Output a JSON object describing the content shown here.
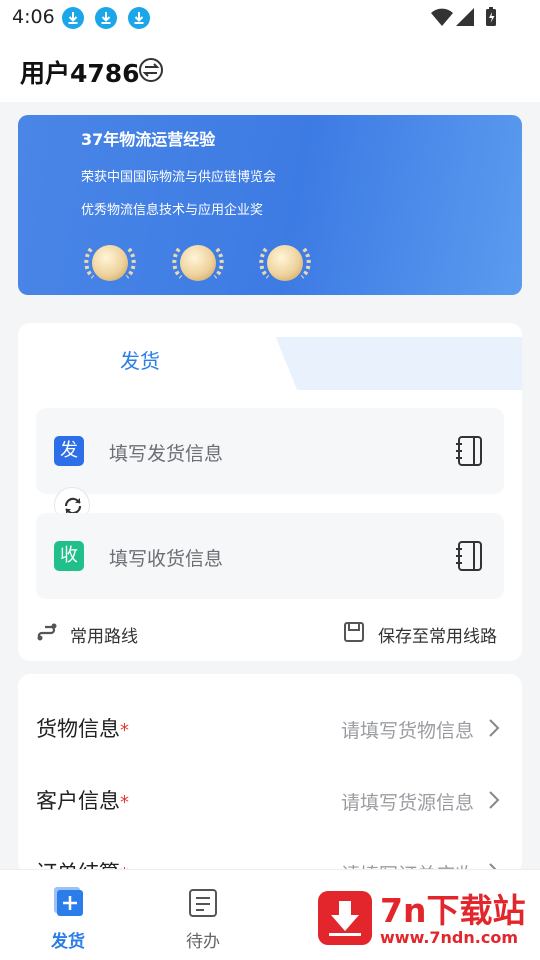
{
  "status_bar": {
    "time": "4:06"
  },
  "header": {
    "user_name": "用户4786"
  },
  "banner": {
    "title": "37年物流运营经验",
    "line1": "荣获中国国际物流与供应链博览会",
    "line2": "优秀物流信息技术与应用企业奖"
  },
  "shipping": {
    "tab_label": "发货",
    "sender": {
      "badge": "发",
      "placeholder": "填写发货信息",
      "color": "#2d6fe8"
    },
    "receiver": {
      "badge": "收",
      "placeholder": "填写收货信息",
      "color": "#21c08b"
    },
    "common_routes": "常用路线",
    "save_route": "保存至常用线路"
  },
  "info_rows": [
    {
      "label": "货物信息",
      "required": "*",
      "placeholder": "请填写货物信息"
    },
    {
      "label": "客户信息",
      "required": "*",
      "placeholder": "请填写货源信息"
    },
    {
      "label": "订单结算",
      "required": "*",
      "placeholder": "请填写订单应收"
    }
  ],
  "bottom_nav": {
    "items": [
      {
        "label": "发货",
        "active": true
      },
      {
        "label": "待办",
        "active": false
      }
    ]
  },
  "watermark": {
    "title": "7n下载站",
    "url": "www.7ndn.com"
  },
  "colors": {
    "accent": "#2b7de9",
    "required": "#e53935",
    "watermark": "#e3262b"
  }
}
